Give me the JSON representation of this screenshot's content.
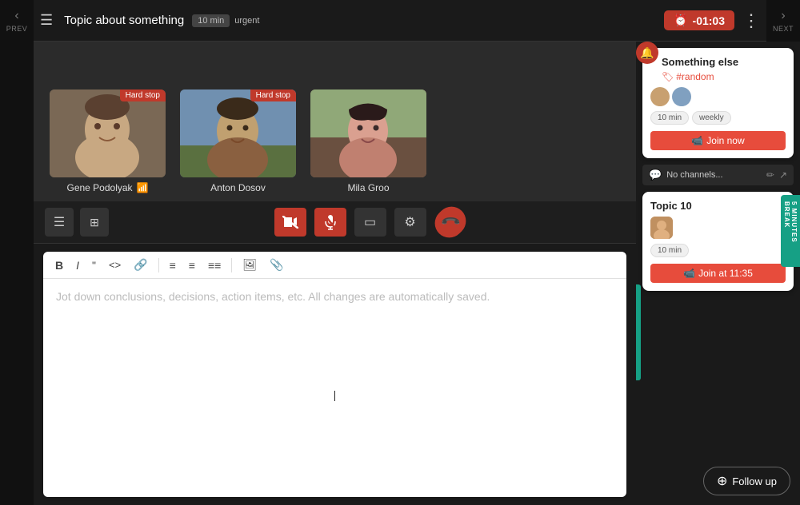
{
  "topbar": {
    "menu_icon": "☰",
    "title": "Topic about something",
    "badge_min": "10 min",
    "badge_urgent": "urgent",
    "timer": "-01:03",
    "more_icon": "⋮"
  },
  "nav": {
    "prev": "PREV",
    "next": "NEXT"
  },
  "participants": [
    {
      "name": "Gene Podolyak",
      "hard_stop": "Hard stop",
      "has_hard_stop": true
    },
    {
      "name": "Anton Dosov",
      "hard_stop": "Hard stop",
      "has_hard_stop": true
    },
    {
      "name": "Mila Groo",
      "has_hard_stop": false
    }
  ],
  "controls": {
    "list_icon": "☰",
    "grid_icon": "⊞",
    "cam_off": "📷",
    "mic_off": "🎤",
    "screen": "▭",
    "settings": "⚙",
    "end": "📞"
  },
  "notes": {
    "placeholder": "Jot down conclusions, decisions, action items, etc. All changes are automatically saved.",
    "tools": [
      "B",
      "I",
      "\"",
      "<>",
      "🔗",
      "≡",
      "≡",
      "≡≡",
      "🖼",
      "📎"
    ]
  },
  "right_panel": {
    "card1": {
      "title": "Something else",
      "channel": "#random",
      "badges": [
        "10 min",
        "weekly"
      ],
      "join_label": "Join now",
      "join_icon": "📹"
    },
    "break_label": "5 MINUTES BREAK",
    "no_channels": "No channels...",
    "card2": {
      "title": "Topic 10",
      "badges": [
        "10 min"
      ],
      "join_label": "Join at 11:35",
      "join_icon": "📹"
    }
  },
  "footer": {
    "follow_up_icon": "+",
    "follow_up_label": "Follow up"
  }
}
